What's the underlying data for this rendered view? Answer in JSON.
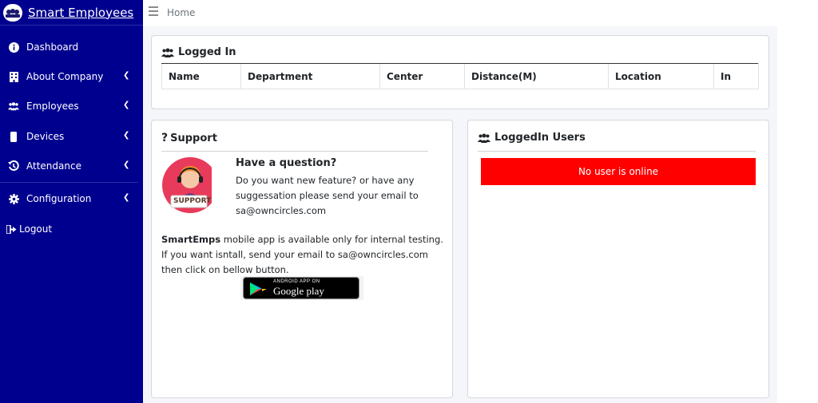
{
  "brand": {
    "title": "Smart Employees"
  },
  "sidebar": {
    "items": [
      {
        "label": "Dashboard"
      },
      {
        "label": "About Company"
      },
      {
        "label": "Employees"
      },
      {
        "label": "Devices"
      },
      {
        "label": "Attendance"
      },
      {
        "label": "Configuration"
      },
      {
        "label": "Logout"
      }
    ]
  },
  "header": {
    "breadcrumb": "Home"
  },
  "logged_in": {
    "title": "Logged In",
    "columns": [
      "Name",
      "Department",
      "Center",
      "Distance(M)",
      "Location",
      "In"
    ]
  },
  "support": {
    "title": "Support",
    "badge": "SUPPORT",
    "question_title": "Have a question?",
    "question_body": "Do you want new feature? or have any suggessation please send your email to sa@owncircles.com",
    "app_brand": "SmartEmps",
    "app_text": " mobile app is available only for internal testing. If you want isntall, send your email to sa@owncircles.com then click on bellow button.",
    "store_small": "ANDROID APP ON",
    "store_big": "Google play"
  },
  "loggedin_users": {
    "title": "LoggedIn Users",
    "empty_message": "No user is online"
  },
  "colors": {
    "sidebar_bg": "#00008f",
    "alert_red": "#ff0000",
    "content_bg": "#f4f6f9"
  }
}
